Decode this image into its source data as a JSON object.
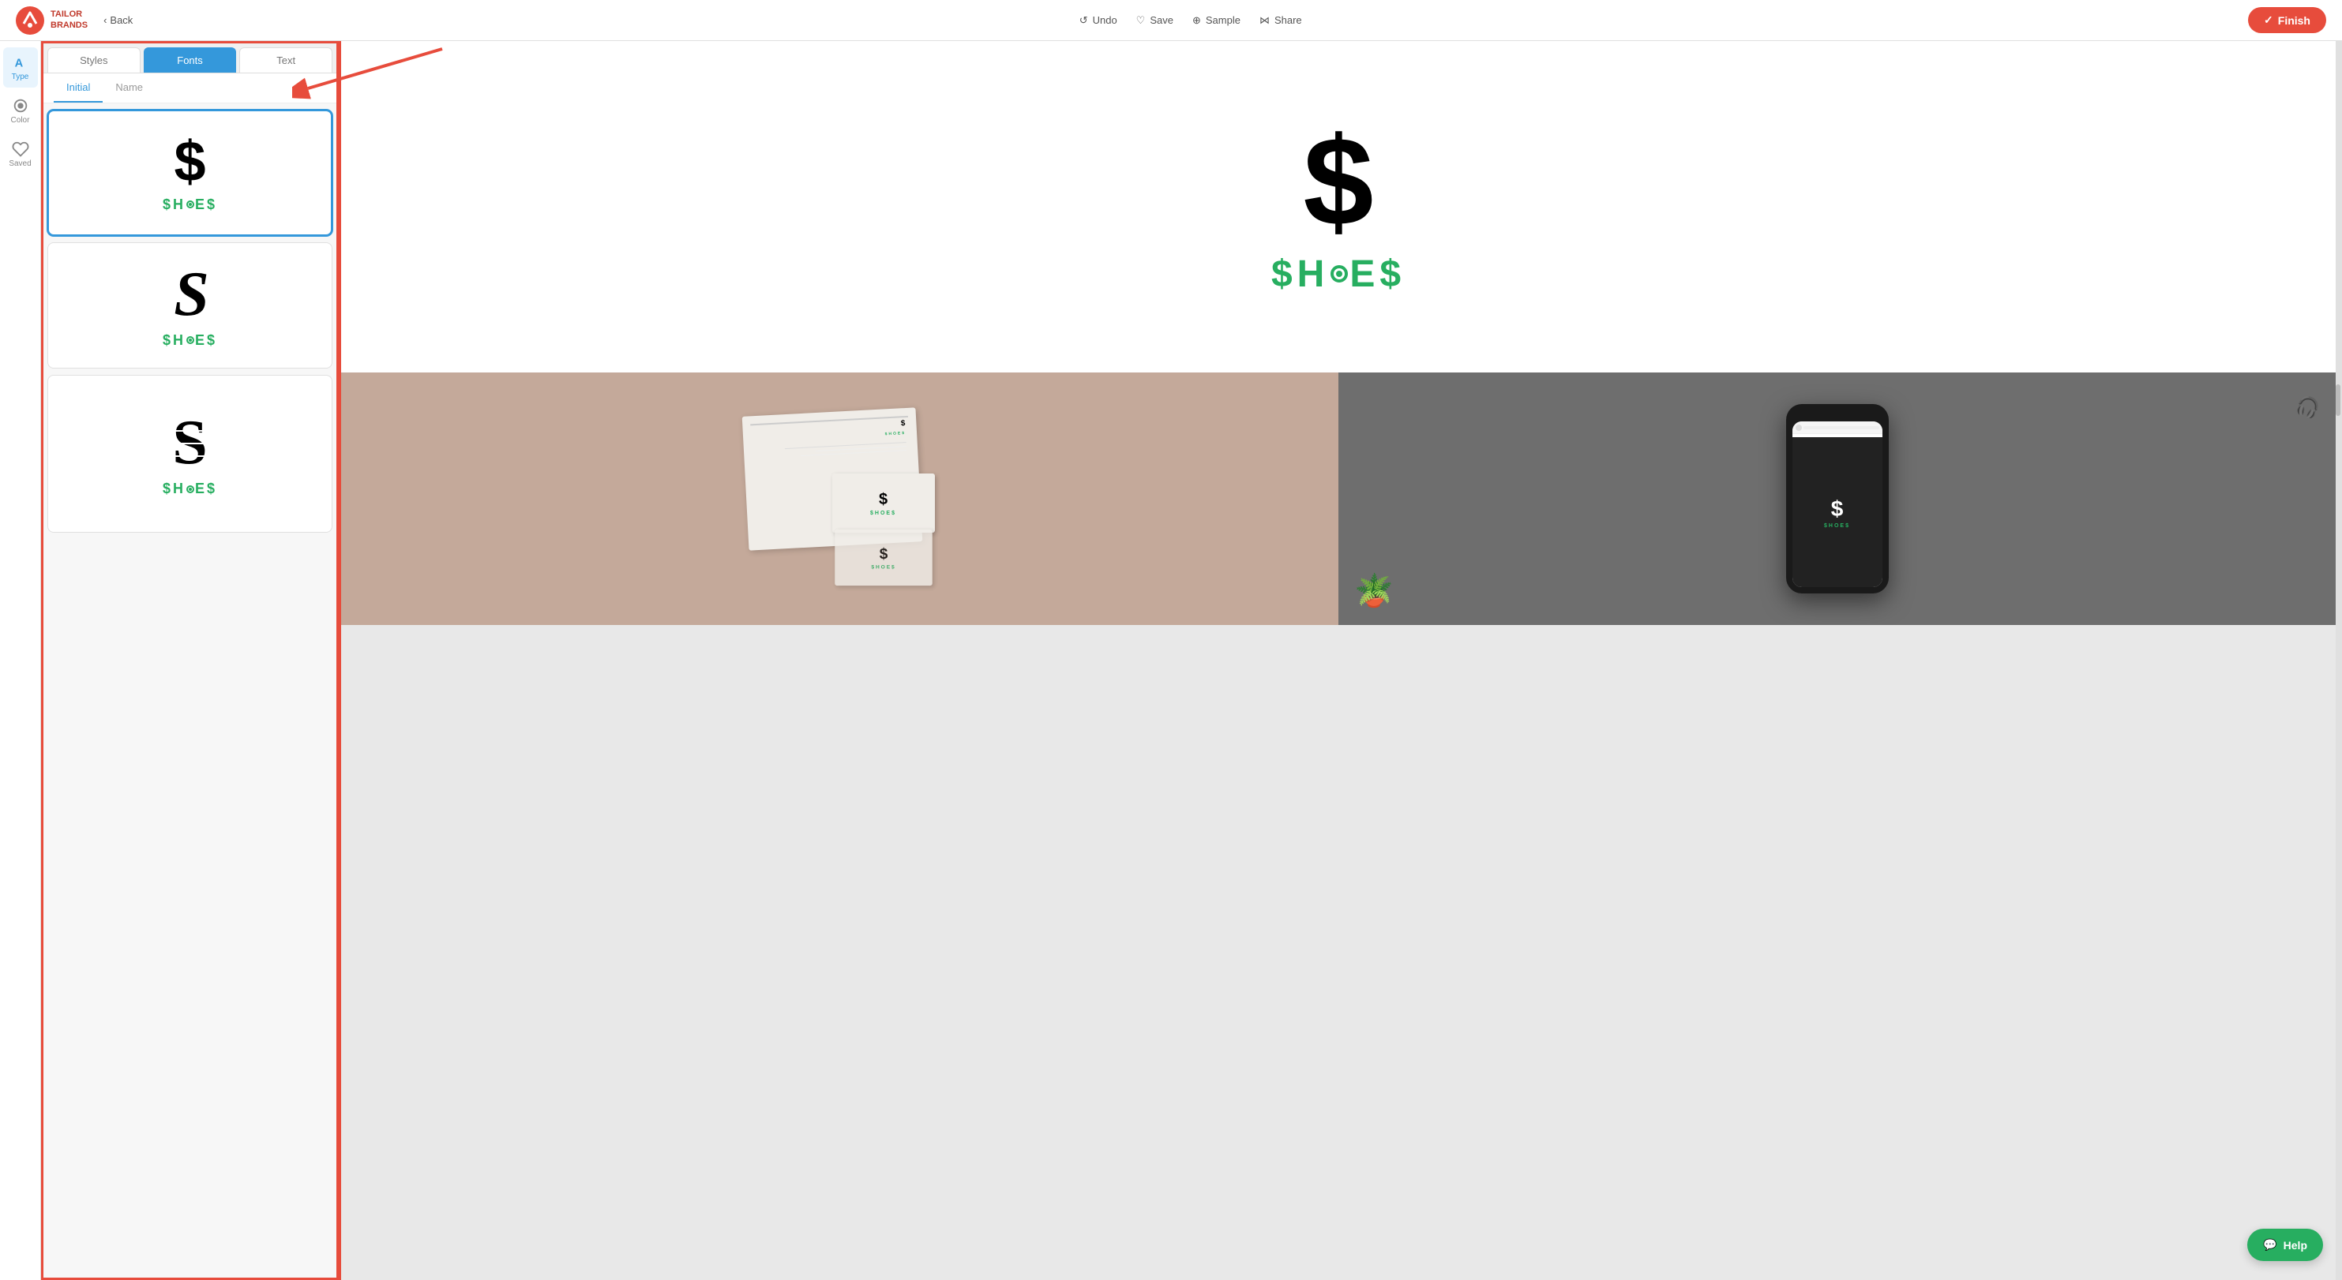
{
  "brand": {
    "name": "TAILOR\nBRANDS"
  },
  "header": {
    "back_label": "Back",
    "undo_label": "Undo",
    "save_label": "Save",
    "sample_label": "Sample",
    "share_label": "Share",
    "finish_label": "Finish"
  },
  "sidebar_icons": [
    {
      "id": "type",
      "label": "Type",
      "active": true
    },
    {
      "id": "color",
      "label": "Color",
      "active": false
    },
    {
      "id": "saved",
      "label": "Saved",
      "active": false
    }
  ],
  "panel": {
    "tabs": [
      {
        "id": "styles",
        "label": "Styles",
        "active": false
      },
      {
        "id": "fonts",
        "label": "Fonts",
        "active": true
      },
      {
        "id": "text",
        "label": "Text",
        "active": false
      }
    ],
    "sub_tabs": [
      {
        "id": "initial",
        "label": "Initial",
        "active": true
      },
      {
        "id": "name",
        "label": "Name",
        "active": false
      }
    ],
    "font_options": [
      {
        "id": "font1",
        "initial": "$",
        "brand": "$HOE$",
        "selected": true
      },
      {
        "id": "font2",
        "initial": "S",
        "brand": "$HOE$",
        "selected": false
      },
      {
        "id": "font3",
        "initial": "S",
        "brand": "$HOE$",
        "selected": false
      }
    ]
  },
  "preview": {
    "symbol": "$",
    "brand_name": "$HOE$"
  },
  "help_label": "Help"
}
